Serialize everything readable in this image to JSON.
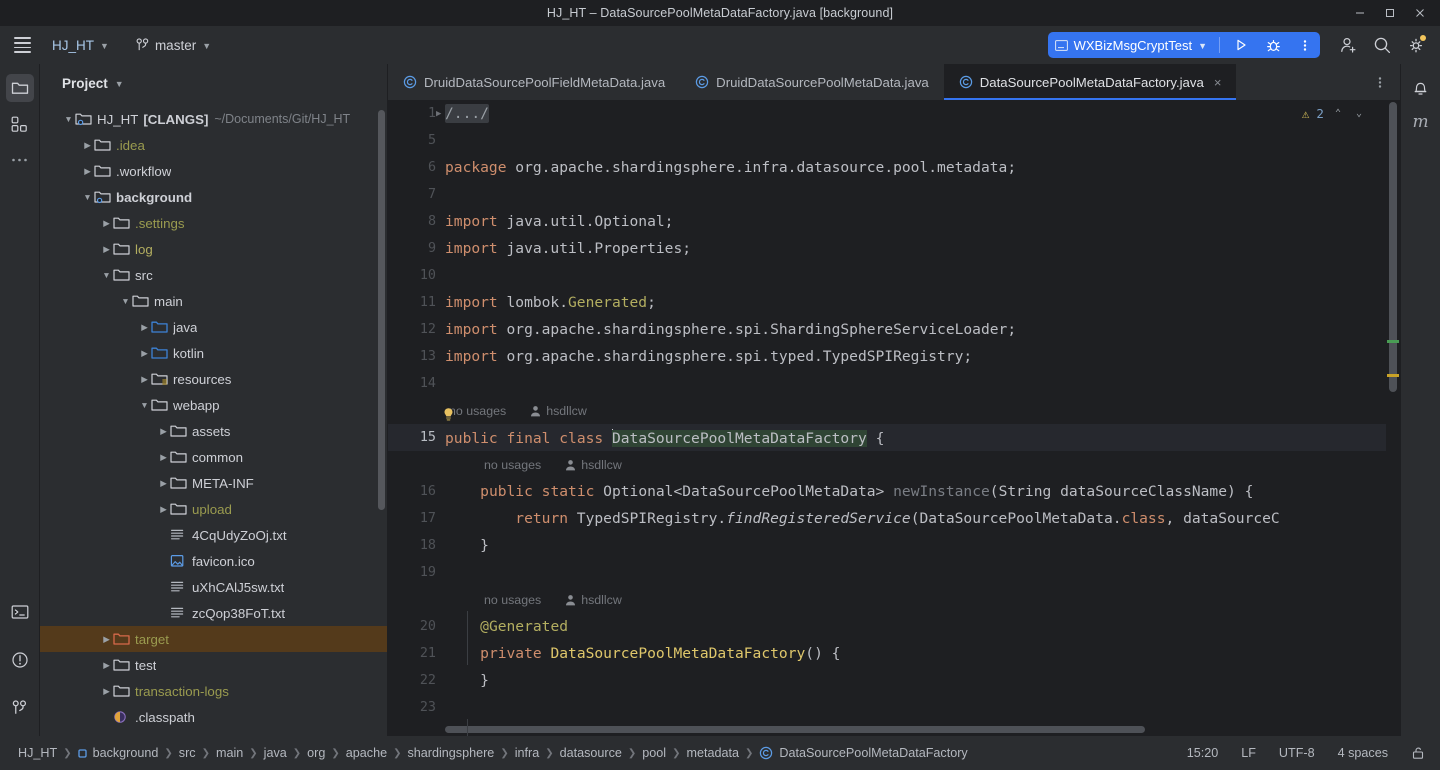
{
  "window": {
    "title": "HJ_HT – DataSourcePoolMetaDataFactory.java [background]",
    "minimize": "–",
    "maximize": "□",
    "close": "×"
  },
  "toolbar": {
    "menu_icon": "hamburger-icon",
    "project_name": "HJ_HT",
    "branch_name": "master",
    "run_config": "WXBizMsgCryptTest",
    "run_label": "Run",
    "debug_label": "Debug",
    "more_label": "More",
    "account_label": "Account",
    "search_label": "Search",
    "settings_label": "Settings"
  },
  "stripe": {
    "project_tool": "Project",
    "commit_tool": "Commit",
    "more_tool": "More tool windows",
    "terminal_tool": "Terminal",
    "problems_tool": "Problems",
    "git_tool": "Git"
  },
  "project_panel": {
    "title": "Project",
    "tree": [
      {
        "label": "HJ_HT",
        "suffix": "[CLANGS]",
        "path": "~/Documents/Git/HJ_HT",
        "indent": 0,
        "arrow": "down",
        "icon": "module-folder",
        "bold_suffix": true,
        "color": "#ced0d6"
      },
      {
        "label": ".idea",
        "indent": 1,
        "arrow": "right",
        "icon": "folder",
        "color": "#9a9b4f"
      },
      {
        "label": ".workflow",
        "indent": 1,
        "arrow": "right",
        "icon": "folder",
        "color": "#ced0d6"
      },
      {
        "label": "background",
        "indent": 1,
        "arrow": "down",
        "icon": "module-folder",
        "color": "#ced0d6",
        "bold": true
      },
      {
        "label": ".settings",
        "indent": 2,
        "arrow": "right",
        "icon": "folder",
        "color": "#9a9b4f"
      },
      {
        "label": "log",
        "indent": 2,
        "arrow": "right",
        "icon": "folder",
        "color": "#b3ae60"
      },
      {
        "label": "src",
        "indent": 2,
        "arrow": "down",
        "icon": "folder",
        "color": "#ced0d6"
      },
      {
        "label": "main",
        "indent": 3,
        "arrow": "down",
        "icon": "folder",
        "color": "#ced0d6"
      },
      {
        "label": "java",
        "indent": 4,
        "arrow": "right",
        "icon": "source-folder",
        "color": "#ced0d6"
      },
      {
        "label": "kotlin",
        "indent": 4,
        "arrow": "right",
        "icon": "source-folder",
        "color": "#ced0d6"
      },
      {
        "label": "resources",
        "indent": 4,
        "arrow": "right",
        "icon": "resource-folder",
        "color": "#ced0d6"
      },
      {
        "label": "webapp",
        "indent": 4,
        "arrow": "down",
        "icon": "folder",
        "color": "#ced0d6"
      },
      {
        "label": "assets",
        "indent": 5,
        "arrow": "right",
        "icon": "folder",
        "color": "#ced0d6"
      },
      {
        "label": "common",
        "indent": 5,
        "arrow": "right",
        "icon": "folder",
        "color": "#ced0d6"
      },
      {
        "label": "META-INF",
        "indent": 5,
        "arrow": "right",
        "icon": "folder",
        "color": "#ced0d6"
      },
      {
        "label": "upload",
        "indent": 5,
        "arrow": "right",
        "icon": "folder",
        "color": "#9a9b4f"
      },
      {
        "label": "4CqUdyZoOj.txt",
        "indent": 5,
        "arrow": "none",
        "icon": "text-file",
        "color": "#ced0d6"
      },
      {
        "label": "favicon.ico",
        "indent": 5,
        "arrow": "none",
        "icon": "image-file",
        "color": "#ced0d6"
      },
      {
        "label": "uXhCAlJ5sw.txt",
        "indent": 5,
        "arrow": "none",
        "icon": "text-file",
        "color": "#ced0d6"
      },
      {
        "label": "zcQop38FoT.txt",
        "indent": 5,
        "arrow": "none",
        "icon": "text-file",
        "color": "#ced0d6"
      },
      {
        "label": "target",
        "indent": 2,
        "arrow": "right",
        "icon": "excluded-folder",
        "color": "#9a9b4f",
        "selected": true
      },
      {
        "label": "test",
        "indent": 2,
        "arrow": "right",
        "icon": "folder",
        "color": "#ced0d6"
      },
      {
        "label": "transaction-logs",
        "indent": 2,
        "arrow": "right",
        "icon": "folder",
        "color": "#9a9b4f"
      },
      {
        "label": ".classpath",
        "indent": 2,
        "arrow": "none",
        "icon": "misc-file",
        "color": "#ced0d6"
      }
    ]
  },
  "editor": {
    "tabs": [
      {
        "label": "DruidDataSourcePoolFieldMetaData.java",
        "icon": "java-class-icon",
        "active": false
      },
      {
        "label": "DruidDataSourcePoolMetaData.java",
        "icon": "java-class-icon",
        "active": false
      },
      {
        "label": "DataSourcePoolMetaDataFactory.java",
        "icon": "java-class-icon",
        "active": true,
        "close": "×"
      }
    ],
    "tab_options": "⋮",
    "notifications": "notifications-bell-icon",
    "inspection": {
      "warning_count": "2",
      "prev": "⌃",
      "next": "⌄"
    },
    "modified_indicator": "m",
    "lines": [
      {
        "num": "1",
        "fold": "›",
        "type": "fold",
        "text": "/.../"
      },
      {
        "num": "5",
        "type": "blank",
        "text": ""
      },
      {
        "num": "6",
        "type": "code",
        "text": "package org.apache.shardingsphere.infra.datasource.pool.metadata;"
      },
      {
        "num": "7",
        "type": "blank",
        "text": ""
      },
      {
        "num": "8",
        "type": "code",
        "text": "import java.util.Optional;"
      },
      {
        "num": "9",
        "type": "code",
        "text": "import java.util.Properties;"
      },
      {
        "num": "10",
        "type": "blank",
        "text": ""
      },
      {
        "num": "11",
        "type": "code",
        "text": "import lombok.Generated;"
      },
      {
        "num": "12",
        "type": "code",
        "text": "import org.apache.shardingsphere.spi.ShardingSphereServiceLoader;"
      },
      {
        "num": "13",
        "type": "code",
        "text": "import org.apache.shardingsphere.spi.typed.TypedSPIRegistry;"
      },
      {
        "num": "14",
        "type": "blank",
        "text": ""
      },
      {
        "num": "15",
        "type": "code",
        "text": "public final class DataSourcePoolMetaDataFactory {",
        "current": true
      },
      {
        "num": "16",
        "type": "code",
        "text": "    public static Optional<DataSourcePoolMetaData> newInstance(String dataSourceClassName) {"
      },
      {
        "num": "17",
        "type": "code",
        "text": "        return TypedSPIRegistry.findRegisteredService(DataSourcePoolMetaData.class, dataSourceC"
      },
      {
        "num": "18",
        "type": "code",
        "text": "    }"
      },
      {
        "num": "19",
        "type": "blank",
        "text": ""
      },
      {
        "num": "20",
        "type": "code",
        "text": "    @Generated"
      },
      {
        "num": "21",
        "type": "code",
        "text": "    private DataSourcePoolMetaDataFactory() {"
      },
      {
        "num": "22",
        "type": "code",
        "text": "    }"
      },
      {
        "num": "23",
        "type": "blank",
        "text": ""
      }
    ],
    "inlay_usages": "no usages",
    "inlay_author": "hsdllcw"
  },
  "status_bar": {
    "breadcrumbs": [
      {
        "label": "HJ_HT",
        "icon": "none"
      },
      {
        "label": "background",
        "icon": "module-icon"
      },
      {
        "label": "src",
        "icon": "none"
      },
      {
        "label": "main",
        "icon": "none"
      },
      {
        "label": "java",
        "icon": "none"
      },
      {
        "label": "org",
        "icon": "none"
      },
      {
        "label": "apache",
        "icon": "none"
      },
      {
        "label": "shardingsphere",
        "icon": "none"
      },
      {
        "label": "infra",
        "icon": "none"
      },
      {
        "label": "datasource",
        "icon": "none"
      },
      {
        "label": "pool",
        "icon": "none"
      },
      {
        "label": "metadata",
        "icon": "none"
      },
      {
        "label": "DataSourcePoolMetaDataFactory",
        "icon": "java-class-icon"
      }
    ],
    "caret_position": "15:20",
    "line_separator": "LF",
    "encoding": "UTF-8",
    "indent": "4 spaces",
    "lock_icon": "read-only-lock-icon"
  },
  "colors": {
    "accent_blue": "#3574f0",
    "keyword_orange": "#cf8e6d",
    "annotation_olive": "#b3ae60",
    "selection_green": "#2f4434",
    "selected_row_brown": "#543a1b",
    "warning_yellow": "#d9c25a"
  }
}
